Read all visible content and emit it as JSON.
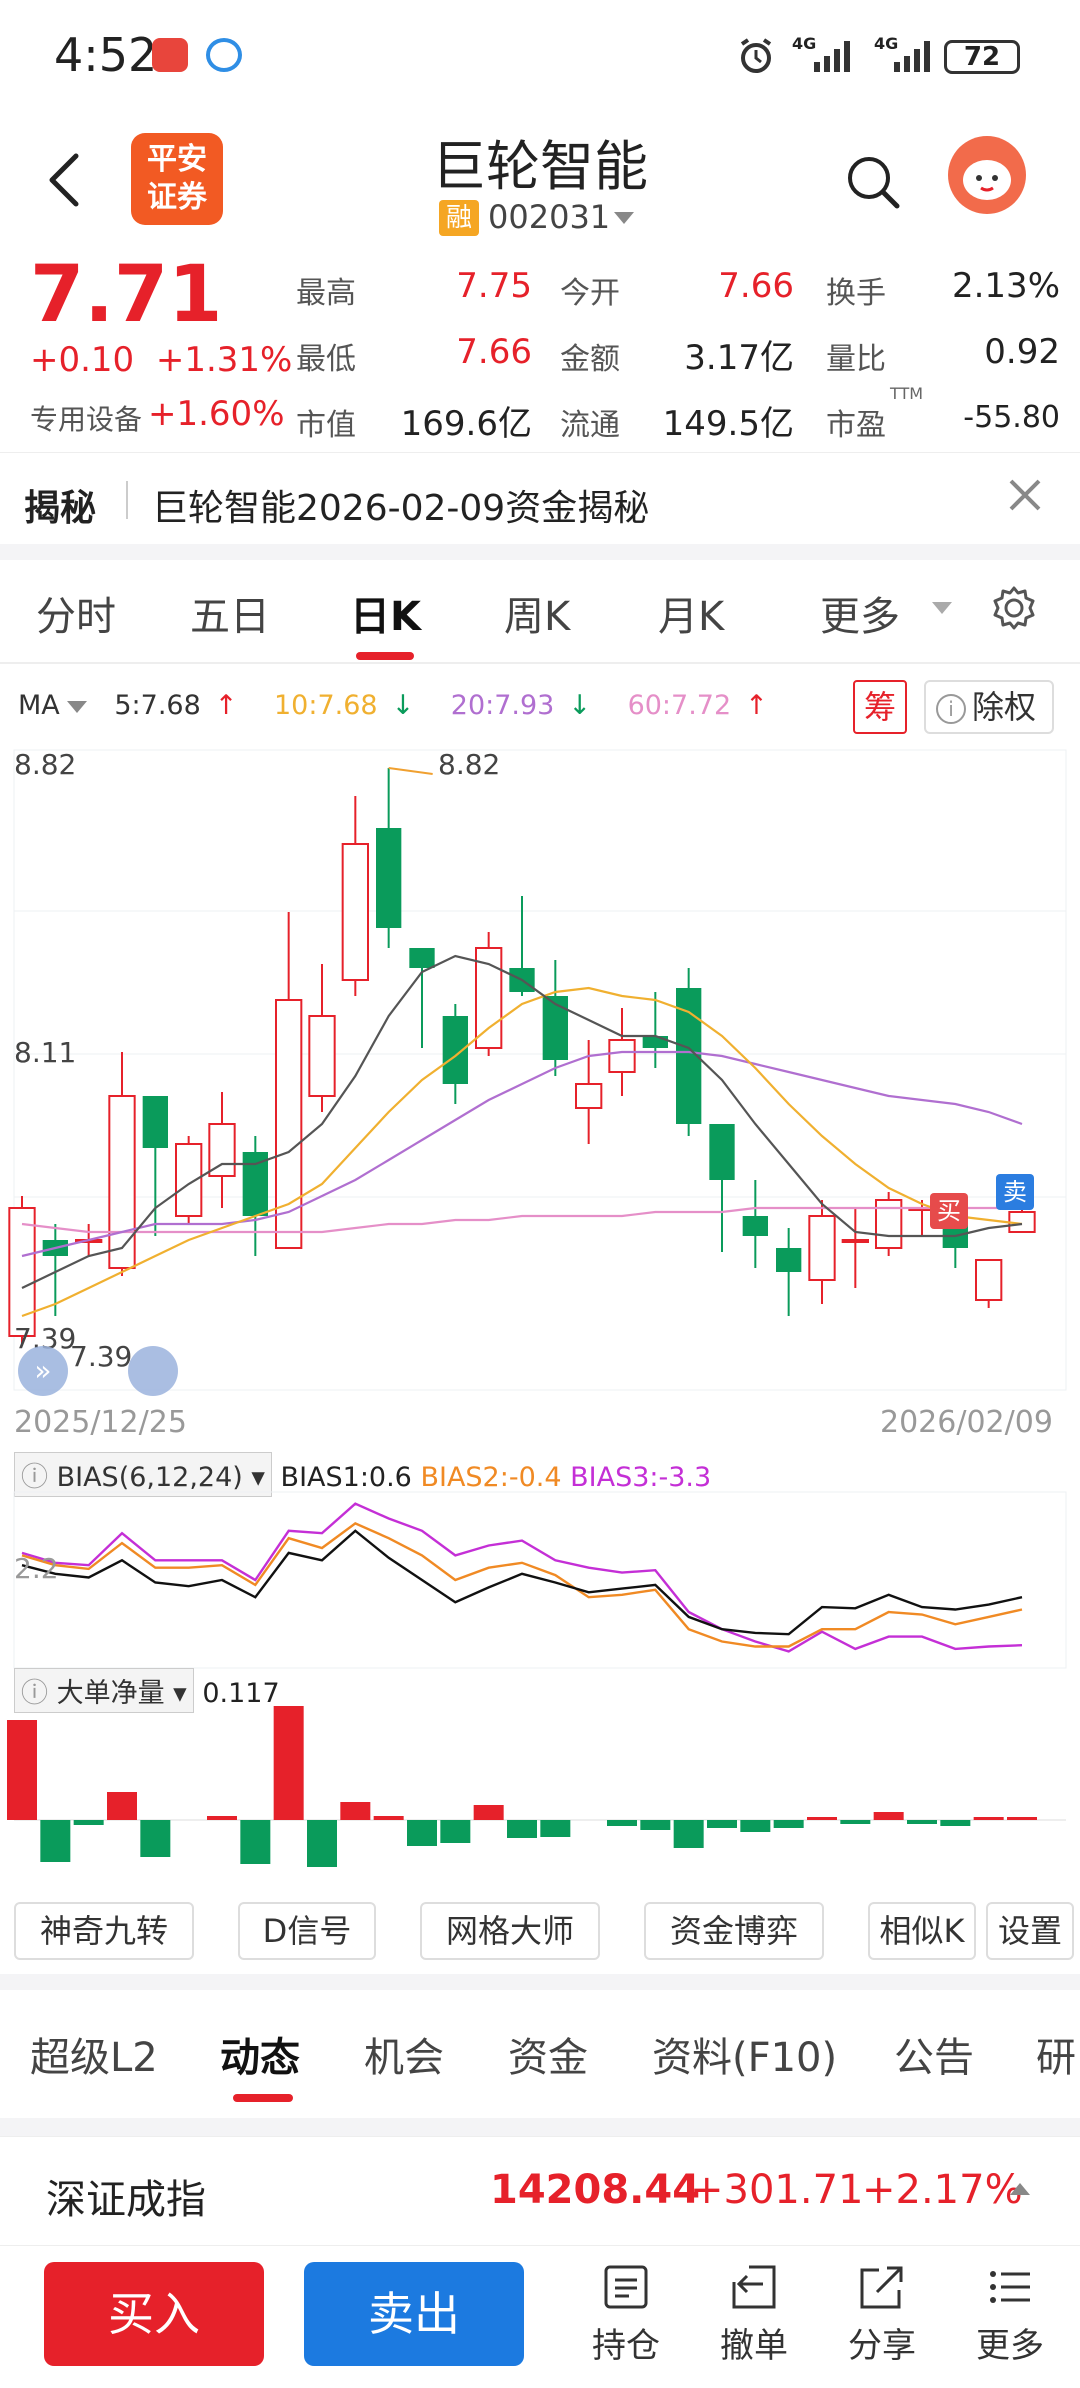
{
  "status": {
    "time": "4:52",
    "signal1": "4G",
    "signal2": "4G",
    "battery": "72"
  },
  "header": {
    "logo": "平安\n证券",
    "logo_line1": "平安",
    "logo_line2": "证券",
    "name": "巨轮智能",
    "tag": "融",
    "code": "002031"
  },
  "quote": {
    "price": "7.71",
    "change": "+0.10",
    "change_pct": "+1.31%",
    "sector": "专用设备",
    "sector_pct": "+1.60%",
    "high_label": "最高",
    "high": "7.75",
    "low_label": "最低",
    "low": "7.66",
    "mcap_label": "市值",
    "mcap": "169.6亿",
    "open_label": "今开",
    "open": "7.66",
    "amount_label": "金额",
    "amount": "3.17亿",
    "float_label": "流通",
    "float": "149.5亿",
    "turnover_label": "换手",
    "turnover": "2.13%",
    "volratio_label": "量比",
    "volratio": "0.92",
    "pe_label": "市盈",
    "pe_sup": "TTM",
    "pe": "-55.80"
  },
  "banner": {
    "tag": "揭秘",
    "text": "巨轮智能2026-02-09资金揭秘"
  },
  "period_tabs": [
    "分时",
    "五日",
    "日K",
    "周K",
    "月K",
    "更多"
  ],
  "ma": {
    "label": "MA",
    "ma5": "5:7.68",
    "ma10": "10:7.68",
    "ma20": "20:7.93",
    "ma60": "60:7.72",
    "chou": "筹",
    "chuquan": "除权"
  },
  "chart": {
    "y_high": "8.82",
    "y_mid": "8.11",
    "y_low": "7.39",
    "max_label": "8.82",
    "min_label": "7.39",
    "date_start": "2025/12/25",
    "date_end": "2026/02/09",
    "buy_mark": "买",
    "sell_mark": "卖"
  },
  "chart_data": {
    "type": "candlestick",
    "y_range": [
      7.39,
      8.82
    ],
    "candles": [
      {
        "o": 7.4,
        "c": 7.72,
        "h": 7.75,
        "l": 7.38
      },
      {
        "o": 7.64,
        "c": 7.6,
        "h": 7.68,
        "l": 7.45
      },
      {
        "o": 7.64,
        "c": 7.64,
        "h": 7.68,
        "l": 7.6
      },
      {
        "o": 7.57,
        "c": 8.0,
        "h": 8.11,
        "l": 7.55
      },
      {
        "o": 8.0,
        "c": 7.87,
        "h": 8.0,
        "l": 7.65
      },
      {
        "o": 7.7,
        "c": 7.88,
        "h": 7.9,
        "l": 7.68
      },
      {
        "o": 7.8,
        "c": 7.93,
        "h": 8.01,
        "l": 7.72
      },
      {
        "o": 7.86,
        "c": 7.7,
        "h": 7.9,
        "l": 7.6
      },
      {
        "o": 7.62,
        "c": 8.24,
        "h": 8.46,
        "l": 7.62
      },
      {
        "o": 8.0,
        "c": 8.2,
        "h": 8.33,
        "l": 7.96
      },
      {
        "o": 8.29,
        "c": 8.63,
        "h": 8.75,
        "l": 8.25
      },
      {
        "o": 8.67,
        "c": 8.42,
        "h": 8.82,
        "l": 8.37
      },
      {
        "o": 8.37,
        "c": 8.32,
        "h": 8.37,
        "l": 8.12
      },
      {
        "o": 8.2,
        "c": 8.03,
        "h": 8.23,
        "l": 7.98
      },
      {
        "o": 8.12,
        "c": 8.37,
        "h": 8.41,
        "l": 8.1
      },
      {
        "o": 8.32,
        "c": 8.26,
        "h": 8.5,
        "l": 8.25
      },
      {
        "o": 8.25,
        "c": 8.09,
        "h": 8.34,
        "l": 8.05
      },
      {
        "o": 7.97,
        "c": 8.03,
        "h": 8.14,
        "l": 7.88
      },
      {
        "o": 8.06,
        "c": 8.14,
        "h": 8.22,
        "l": 8.0
      },
      {
        "o": 8.15,
        "c": 8.12,
        "h": 8.26,
        "l": 8.07
      },
      {
        "o": 8.27,
        "c": 7.93,
        "h": 8.32,
        "l": 7.9
      },
      {
        "o": 7.93,
        "c": 7.79,
        "h": 7.93,
        "l": 7.61
      },
      {
        "o": 7.7,
        "c": 7.65,
        "h": 7.79,
        "l": 7.57
      },
      {
        "o": 7.62,
        "c": 7.56,
        "h": 7.67,
        "l": 7.45
      },
      {
        "o": 7.54,
        "c": 7.7,
        "h": 7.74,
        "l": 7.48
      },
      {
        "o": 7.64,
        "c": 7.64,
        "h": 7.72,
        "l": 7.52
      },
      {
        "o": 7.62,
        "c": 7.74,
        "h": 7.76,
        "l": 7.6
      },
      {
        "o": 7.72,
        "c": 7.72,
        "h": 7.74,
        "l": 7.65
      },
      {
        "o": 7.71,
        "c": 7.62,
        "h": 7.72,
        "l": 7.57
      },
      {
        "o": 7.49,
        "c": 7.59,
        "h": 7.59,
        "l": 7.47
      },
      {
        "o": 7.66,
        "c": 7.71,
        "h": 7.75,
        "l": 7.66
      }
    ],
    "ma5": [
      7.52,
      7.56,
      7.6,
      7.62,
      7.72,
      7.78,
      7.83,
      7.83,
      7.86,
      7.93,
      8.05,
      8.2,
      8.31,
      8.35,
      8.33,
      8.29,
      8.23,
      8.19,
      8.15,
      8.15,
      8.12,
      8.04,
      7.93,
      7.83,
      7.73,
      7.66,
      7.65,
      7.65,
      7.65,
      7.67,
      7.68
    ],
    "ma10": [
      7.45,
      7.48,
      7.52,
      7.56,
      7.6,
      7.64,
      7.67,
      7.7,
      7.73,
      7.78,
      7.87,
      7.96,
      8.04,
      8.1,
      8.17,
      8.23,
      8.26,
      8.27,
      8.25,
      8.24,
      8.21,
      8.15,
      8.07,
      7.98,
      7.9,
      7.83,
      7.77,
      7.73,
      7.7,
      7.69,
      7.68
    ],
    "ma20": [
      7.6,
      7.62,
      7.64,
      7.66,
      7.68,
      7.68,
      7.68,
      7.69,
      7.71,
      7.75,
      7.79,
      7.84,
      7.89,
      7.94,
      7.99,
      8.03,
      8.07,
      8.1,
      8.11,
      8.11,
      8.11,
      8.1,
      8.08,
      8.06,
      8.04,
      8.02,
      8.0,
      7.99,
      7.98,
      7.96,
      7.93
    ],
    "ma60": [
      7.68,
      7.67,
      7.66,
      7.66,
      7.66,
      7.66,
      7.66,
      7.66,
      7.66,
      7.66,
      7.67,
      7.68,
      7.68,
      7.69,
      7.69,
      7.7,
      7.7,
      7.7,
      7.7,
      7.71,
      7.71,
      7.71,
      7.72,
      7.72,
      7.72,
      7.72,
      7.72,
      7.72,
      7.72,
      7.72,
      7.72
    ],
    "bias1": [
      3.2,
      2.5,
      2.2,
      3.6,
      1.8,
      1.5,
      2.0,
      0.6,
      4.2,
      3.6,
      6.0,
      3.8,
      2.0,
      0.2,
      1.4,
      2.5,
      1.8,
      1.0,
      1.3,
      1.6,
      -1.0,
      -2.0,
      -2.3,
      -2.4,
      -0.2,
      -0.3,
      0.8,
      -0.2,
      -0.4,
      0.0,
      0.6
    ],
    "bias2": [
      4.0,
      3.2,
      2.9,
      5.0,
      3.0,
      3.0,
      3.2,
      1.6,
      5.4,
      4.6,
      6.6,
      5.4,
      4.0,
      2.0,
      3.0,
      3.4,
      2.4,
      0.6,
      0.8,
      1.2,
      -2.0,
      -3.0,
      -3.4,
      -3.4,
      -2.0,
      -2.0,
      -0.6,
      -0.8,
      -1.6,
      -1.0,
      -0.4
    ],
    "bias3": [
      4.2,
      3.4,
      3.2,
      5.8,
      3.6,
      3.6,
      3.6,
      2.0,
      6.0,
      5.8,
      8.2,
      7.0,
      6.0,
      4.0,
      4.8,
      5.2,
      3.6,
      3.0,
      2.6,
      2.8,
      -0.6,
      -2.0,
      -3.0,
      -3.8,
      -2.2,
      -3.6,
      -2.6,
      -2.6,
      -3.6,
      -3.4,
      -3.3
    ],
    "bias_label": "BIAS(6,12,24)",
    "bias1_label": "BIAS1:0.6",
    "bias2_label": "BIAS2:-0.4",
    "bias3_label": "BIAS3:-3.3",
    "bias_tick": "2.2",
    "dadan": [
      1.0,
      -0.42,
      -0.05,
      0.28,
      -0.37,
      0,
      0.04,
      -0.44,
      1.15,
      -0.47,
      0.18,
      0.04,
      -0.26,
      -0.23,
      0.15,
      -0.18,
      -0.17,
      0,
      -0.06,
      -0.1,
      -0.28,
      -0.08,
      -0.12,
      -0.08,
      0.01,
      -0.04,
      0.08,
      -0.04,
      -0.06,
      0.02,
      0.02
    ],
    "dadan_label": "大单净量",
    "dadan_value": "0.117"
  },
  "tools": [
    "神奇九转",
    "D信号",
    "网格大师",
    "资金博弈",
    "相似K",
    "设置"
  ],
  "sub_tabs": [
    "超级L2",
    "动态",
    "机会",
    "资金",
    "资料(F10)",
    "公告",
    "研"
  ],
  "index": {
    "name": "深证成指",
    "value": "14208.44",
    "change": "+301.71",
    "pct": "+2.17%"
  },
  "actions": {
    "buy": "买入",
    "sell": "卖出",
    "position": "持仓",
    "cancel": "撤单",
    "share": "分享",
    "more": "更多"
  },
  "colors": {
    "up": "#e6212a",
    "down": "#0a9b5b",
    "ma5": "#555555",
    "ma10": "#f0b030",
    "ma20": "#b06fd0",
    "ma60": "#e58fc8",
    "sell_blue": "#1c7ae0"
  }
}
